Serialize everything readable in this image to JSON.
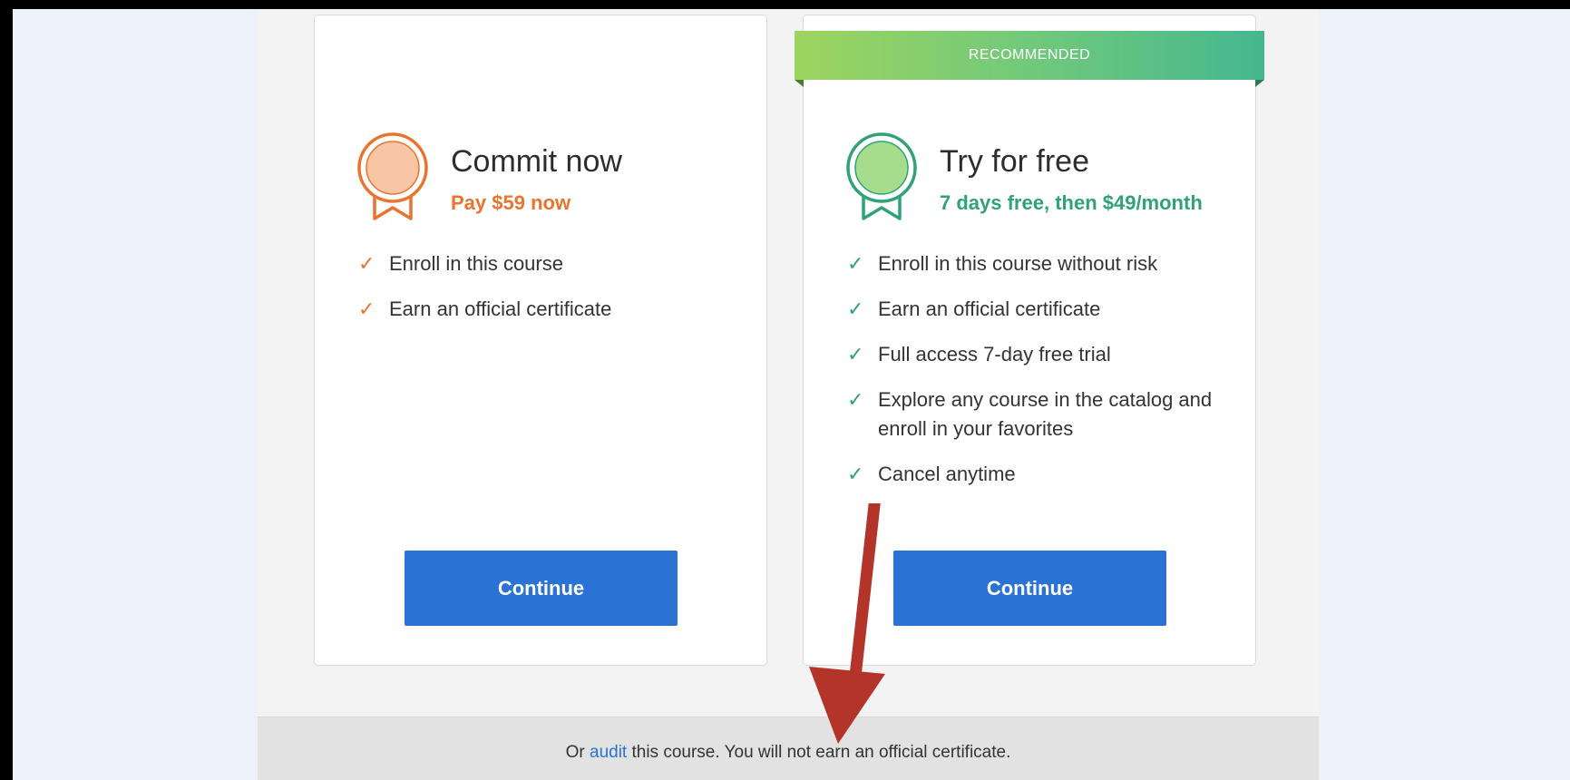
{
  "plans": {
    "commit": {
      "title": "Commit now",
      "subtitle": "Pay $59 now",
      "features": [
        "Enroll in this course",
        "Earn an official certificate"
      ],
      "button": "Continue",
      "accent": "#e9742f"
    },
    "trial": {
      "ribbon": "RECOMMENDED",
      "title": "Try for free",
      "subtitle": "7 days free, then $49/month",
      "features": [
        "Enroll in this course without risk",
        "Earn an official certificate",
        "Full access 7-day free trial",
        "Explore any course in the catalog and enroll in your favorites",
        "Cancel anytime"
      ],
      "button": "Continue",
      "accent": "#2fa276"
    }
  },
  "audit": {
    "prefix": "Or ",
    "link": "audit",
    "suffix": " this course. You will not earn an official certificate."
  },
  "icons": {
    "check": "✓",
    "badge": "ribbon-medal-icon",
    "arrow": "red-arrow-annotation"
  },
  "colors": {
    "button": "#2a73d4",
    "link": "#2a73d4",
    "annotation_arrow": "#b5342a"
  }
}
